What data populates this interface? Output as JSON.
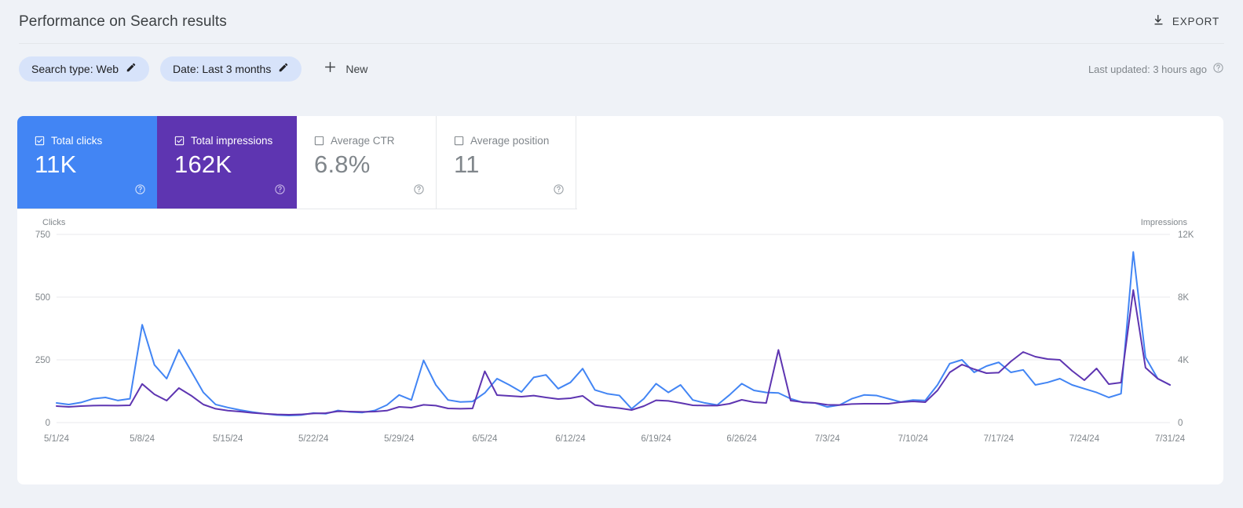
{
  "header": {
    "title": "Performance on Search results",
    "export_label": "EXPORT",
    "export_icon": "download-icon"
  },
  "filters": {
    "chips": [
      {
        "label": "Search type: Web",
        "icon": "pencil-icon"
      },
      {
        "label": "Date: Last 3 months",
        "icon": "pencil-icon"
      }
    ],
    "new_label": "New",
    "new_icon": "plus-icon",
    "last_updated": "Last updated: 3 hours ago",
    "last_updated_icon": "help-icon"
  },
  "metrics": [
    {
      "name": "Total clicks",
      "value": "11K",
      "checked": true,
      "state": "active-clicks",
      "color": "#4285f4",
      "help_icon": "help-icon"
    },
    {
      "name": "Total impressions",
      "value": "162K",
      "checked": true,
      "state": "active-impr",
      "color": "#5e35b1",
      "help_icon": "help-icon"
    },
    {
      "name": "Average CTR",
      "value": "6.8%",
      "checked": false,
      "state": "inactive",
      "color": "#80868b",
      "help_icon": "help-icon"
    },
    {
      "name": "Average position",
      "value": "11",
      "checked": false,
      "state": "inactive",
      "color": "#80868b",
      "help_icon": "help-icon"
    }
  ],
  "chart_data": {
    "type": "line",
    "title": "",
    "xlabel": "",
    "ylabel": "Clicks",
    "y2label": "Impressions",
    "grid": true,
    "legend_position": "none",
    "ylim": [
      0,
      750
    ],
    "y2lim": [
      0,
      12000
    ],
    "yticks": [
      0,
      250,
      500,
      750
    ],
    "ytick_labels": [
      "0",
      "250",
      "500",
      "750"
    ],
    "y2ticks": [
      0,
      4000,
      8000,
      12000
    ],
    "y2tick_labels": [
      "0",
      "4K",
      "8K",
      "12K"
    ],
    "x_tick_labels": [
      "5/1/24",
      "5/8/24",
      "5/15/24",
      "5/22/24",
      "5/29/24",
      "6/5/24",
      "6/12/24",
      "6/19/24",
      "6/26/24",
      "7/3/24",
      "7/10/24",
      "7/17/24",
      "7/24/24",
      "7/31/24"
    ],
    "x_tick_indices": [
      0,
      7,
      14,
      21,
      28,
      35,
      42,
      49,
      56,
      63,
      70,
      77,
      84,
      91
    ],
    "x_start": "5/1/24",
    "x_end": "7/31/24",
    "n_points": 92,
    "series": [
      {
        "name": "Clicks",
        "color": "#4285f4",
        "axis": "left",
        "values": [
          78,
          72,
          80,
          95,
          100,
          88,
          95,
          390,
          230,
          175,
          290,
          205,
          120,
          72,
          60,
          50,
          42,
          35,
          30,
          28,
          30,
          38,
          35,
          48,
          42,
          40,
          48,
          70,
          110,
          90,
          248,
          150,
          90,
          82,
          84,
          118,
          175,
          150,
          122,
          180,
          190,
          135,
          160,
          215,
          130,
          115,
          108,
          55,
          95,
          155,
          120,
          150,
          90,
          78,
          70,
          110,
          155,
          128,
          120,
          118,
          95,
          80,
          78,
          62,
          70,
          95,
          110,
          108,
          95,
          82,
          90,
          88,
          150,
          235,
          250,
          200,
          225,
          240,
          200,
          210,
          150,
          160,
          175,
          150,
          135,
          120,
          100,
          115,
          680,
          260,
          175,
          150
        ]
      },
      {
        "name": "Impressions",
        "color": "#5e35b1",
        "axis": "right",
        "values": [
          1050,
          1000,
          1050,
          1080,
          1090,
          1080,
          1100,
          2460,
          1800,
          1400,
          2200,
          1720,
          1150,
          880,
          760,
          700,
          620,
          560,
          520,
          500,
          520,
          580,
          600,
          720,
          700,
          680,
          700,
          760,
          1000,
          950,
          1130,
          1080,
          900,
          880,
          900,
          3270,
          1750,
          1700,
          1650,
          1720,
          1600,
          1500,
          1550,
          1700,
          1120,
          1000,
          920,
          800,
          1050,
          1420,
          1380,
          1250,
          1100,
          1080,
          1080,
          1200,
          1450,
          1300,
          1250,
          4630,
          1400,
          1300,
          1250,
          1130,
          1120,
          1180,
          1200,
          1200,
          1200,
          1300,
          1350,
          1300,
          2050,
          3200,
          3700,
          3400,
          3150,
          3180,
          3900,
          4500,
          4200,
          4050,
          4000,
          3300,
          2700,
          3450,
          2450,
          2550,
          8450,
          3500,
          2800,
          2400
        ]
      }
    ]
  }
}
